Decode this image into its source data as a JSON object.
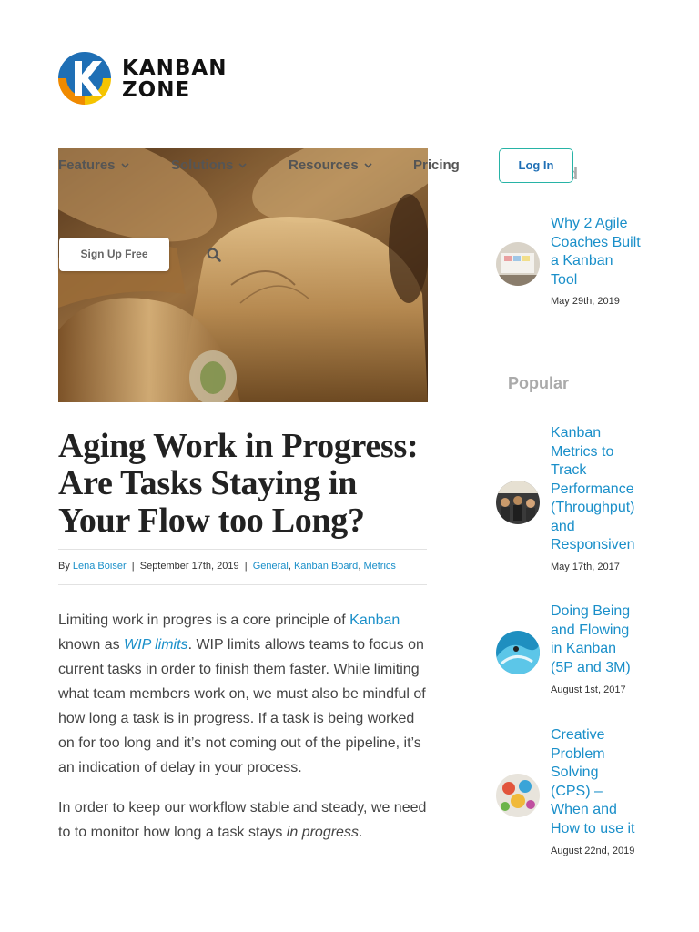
{
  "brand": {
    "line1": "KANBAN",
    "line2": "ZONE"
  },
  "nav": {
    "items": [
      {
        "label": "Features"
      },
      {
        "label": "Solutions"
      },
      {
        "label": "Resources"
      },
      {
        "label": "Pricing"
      }
    ],
    "login_label": "Log In",
    "signup_label": "Sign Up Free"
  },
  "article": {
    "title": "Aging Work in Progress: Are Tasks Staying in Your Flow too Long?",
    "meta": {
      "by": "By",
      "author": "Lena Boiser",
      "date": "September 17th, 2019",
      "categories": [
        "General",
        "Kanban Board",
        "Metrics"
      ]
    },
    "p1": {
      "t1": "Limiting work in progres is a core principle of ",
      "link1": "Kanban",
      "t2": " known as ",
      "link2": "WIP limits",
      "t3": ". WIP limits allows teams to focus on current tasks in order to finish them faster. While limiting what team members work on, we must also be mindful of how long a task is in progress. If a task is being worked on for too long and it’s not coming out of the pipeline, it’s an indication of delay in your process."
    },
    "p2": {
      "t1": "In order to keep our workflow stable and steady, we need to to monitor how long a task stays ",
      "em": "in progress",
      "t2": "."
    }
  },
  "sidebar": {
    "recent_heading_fragment": "d",
    "recent": [
      {
        "title": "Why 2 Agile Coaches Built a Kanban Tool",
        "date": "May 29th, 2019"
      }
    ],
    "popular_heading": "Popular",
    "popular": [
      {
        "title": "Kanban Metrics to Track Performance (Throughput) and Responsiveness (Cycle Time)",
        "date": "May 17th, 2017"
      },
      {
        "title": "Doing Being and Flowing in Kanban (5P and 3M)",
        "date": "August 1st, 2017"
      },
      {
        "title": "Creative Problem Solving (CPS) – When and How to use it",
        "date": "August 22nd, 2019"
      }
    ]
  },
  "colors": {
    "link": "#1a8fc9",
    "teal": "#27b3a6",
    "brand_blue": "#1f6fb5",
    "brand_yellow": "#f5c400",
    "brand_orange": "#f08a00"
  }
}
